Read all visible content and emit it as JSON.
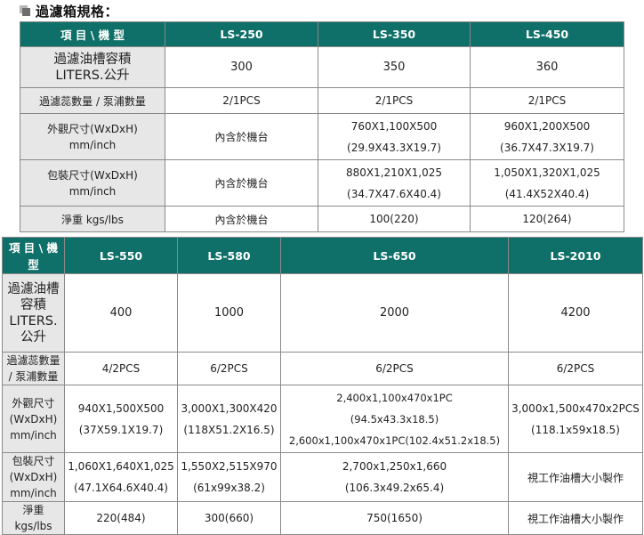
{
  "title": "過濾箱規格：",
  "table1": {
    "header": [
      "項 目 \\ 機 型",
      "LS-250",
      "LS-350",
      "LS-450"
    ],
    "rows": [
      {
        "label": [
          "過濾油槽容積",
          "LITERS.公升"
        ],
        "cells": [
          [
            "300"
          ],
          [
            "350"
          ],
          [
            "360"
          ]
        ]
      },
      {
        "label": [
          "過濾蕊數量 / 泵浦數量"
        ],
        "cells": [
          [
            "2/1PCS"
          ],
          [
            "2/1PCS"
          ],
          [
            "2/1PCS"
          ]
        ]
      },
      {
        "label": [
          "外觀尺寸(WxDxH)",
          "mm/inch"
        ],
        "cells": [
          [
            "內含於機台"
          ],
          [
            "760X1,100X500",
            "(29.9X43.3X19.7)"
          ],
          [
            "960X1,200X500",
            "(36.7X47.3X19.7)"
          ]
        ]
      },
      {
        "label": [
          "包裝尺寸(WxDxH)",
          "mm/inch"
        ],
        "cells": [
          [
            "內含於機台"
          ],
          [
            "880X1,210X1,025",
            "(34.7X47.6X40.4)"
          ],
          [
            "1,050X1,320X1,025",
            "(41.4X52X40.4)"
          ]
        ]
      },
      {
        "label": [
          "淨重 kgs/lbs"
        ],
        "cells": [
          [
            "內含於機台"
          ],
          [
            "100(220)"
          ],
          [
            "120(264)"
          ]
        ]
      }
    ]
  },
  "table2": {
    "header": [
      "項 目 \\ 機 型",
      "LS-550",
      "LS-580",
      "LS-650",
      "LS-2010"
    ],
    "rows": [
      {
        "label": [
          "過濾油槽",
          "容積",
          "LITERS.",
          "公升"
        ],
        "cells": [
          [
            "400"
          ],
          [
            "1000"
          ],
          [
            "2000"
          ],
          [
            "4200"
          ]
        ]
      },
      {
        "label": [
          "過濾蕊數量",
          "/ 泵浦數量"
        ],
        "cells": [
          [
            "4/2PCS"
          ],
          [
            "6/2PCS"
          ],
          [
            "6/2PCS"
          ],
          [
            "6/2PCS"
          ]
        ]
      },
      {
        "label": [
          "外觀尺寸",
          "(WxDxH)",
          "mm/inch"
        ],
        "cells": [
          [
            "940X1,500X500",
            "(37X59.1X19.7)"
          ],
          [
            "3,000X1,300X420",
            "(118X51.2X16.5)"
          ],
          [
            "2,400x1,100x470x1PC",
            "(94.5x43.3x18.5)",
            "2,600x1,100x470x1PC(102.4x51.2x18.5)"
          ],
          [
            "3,000x1,500x470x2PCS",
            "(118.1x59x18.5)"
          ]
        ]
      },
      {
        "label": [
          "包裝尺寸",
          "(WxDxH)",
          "mm/inch"
        ],
        "cells": [
          [
            "1,060X1,640X1,025",
            "(47.1X64.6X40.4)"
          ],
          [
            "1,550X2,515X970",
            "(61x99x38.2)"
          ],
          [
            "2,700x1,250x1,660",
            "(106.3x49.2x65.4)"
          ],
          [
            "視工作油槽大小製作"
          ]
        ]
      },
      {
        "label": [
          "淨重",
          "kgs/lbs"
        ],
        "cells": [
          [
            "220(484)"
          ],
          [
            "300(660)"
          ],
          [
            "750(1650)"
          ],
          [
            "視工作油槽大小製作"
          ]
        ]
      }
    ]
  }
}
